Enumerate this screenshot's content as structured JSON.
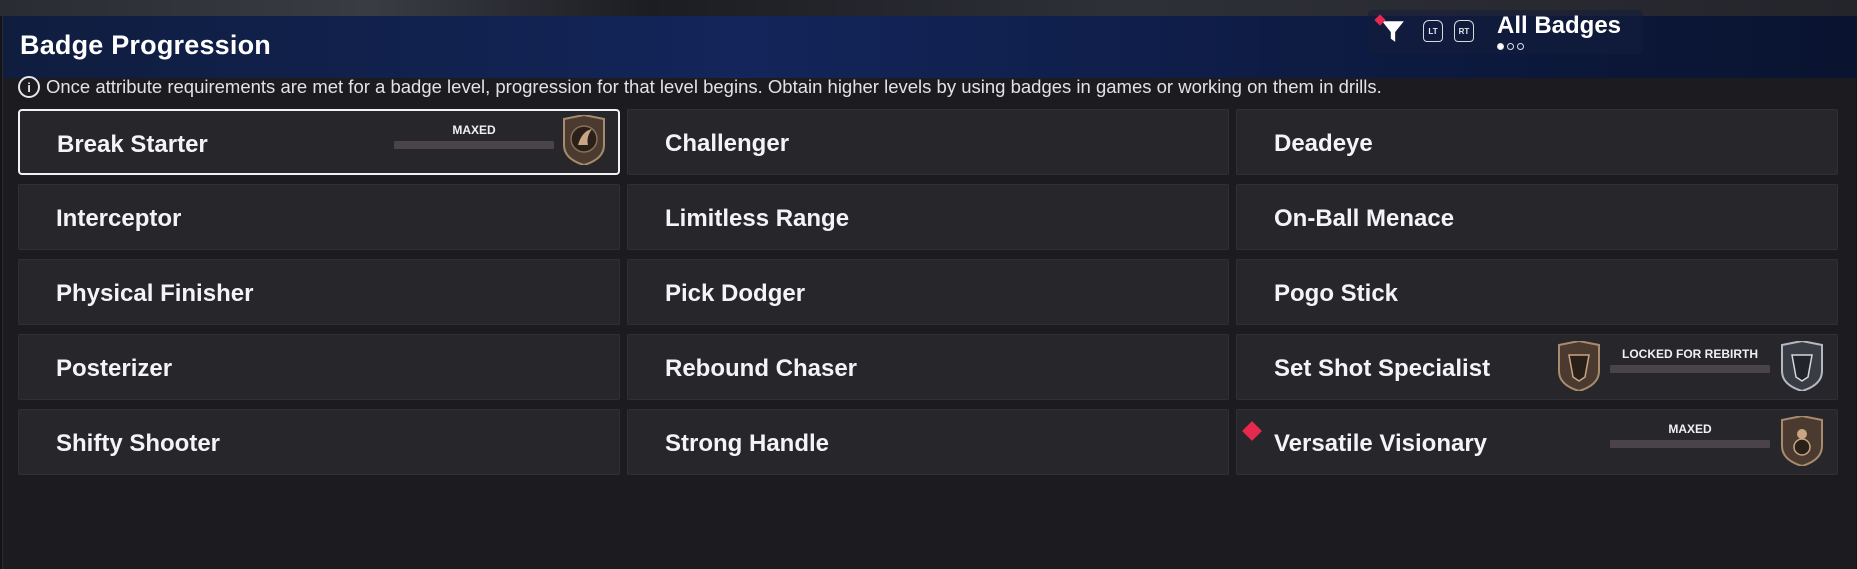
{
  "header": {
    "title": "Badge Progression",
    "filter_label": "All Badges",
    "lt_label": "LT",
    "rt_label": "RT",
    "page_count": 3,
    "current_page": 1
  },
  "info": {
    "text": "Once attribute requirements are met for a badge level, progression for that level begins. Obtain higher levels by using badges in games or working on them in drills."
  },
  "badges": [
    {
      "name": "Break Starter",
      "status": "MAXED",
      "selected": true
    },
    {
      "name": "Challenger"
    },
    {
      "name": "Deadeye"
    },
    {
      "name": "Interceptor"
    },
    {
      "name": "Limitless Range"
    },
    {
      "name": "On-Ball Menace"
    },
    {
      "name": "Physical Finisher"
    },
    {
      "name": "Pick Dodger"
    },
    {
      "name": "Pogo Stick"
    },
    {
      "name": "Posterizer"
    },
    {
      "name": "Rebound Chaser"
    },
    {
      "name": "Set Shot Specialist",
      "status": "LOCKED FOR REBIRTH"
    },
    {
      "name": "Shifty Shooter"
    },
    {
      "name": "Strong Handle"
    },
    {
      "name": "Versatile Visionary",
      "status": "MAXED",
      "new": true
    }
  ],
  "colors": {
    "accent_new": "#e8294f",
    "header_bg": "#13255a",
    "card_bg": "#26262b"
  }
}
